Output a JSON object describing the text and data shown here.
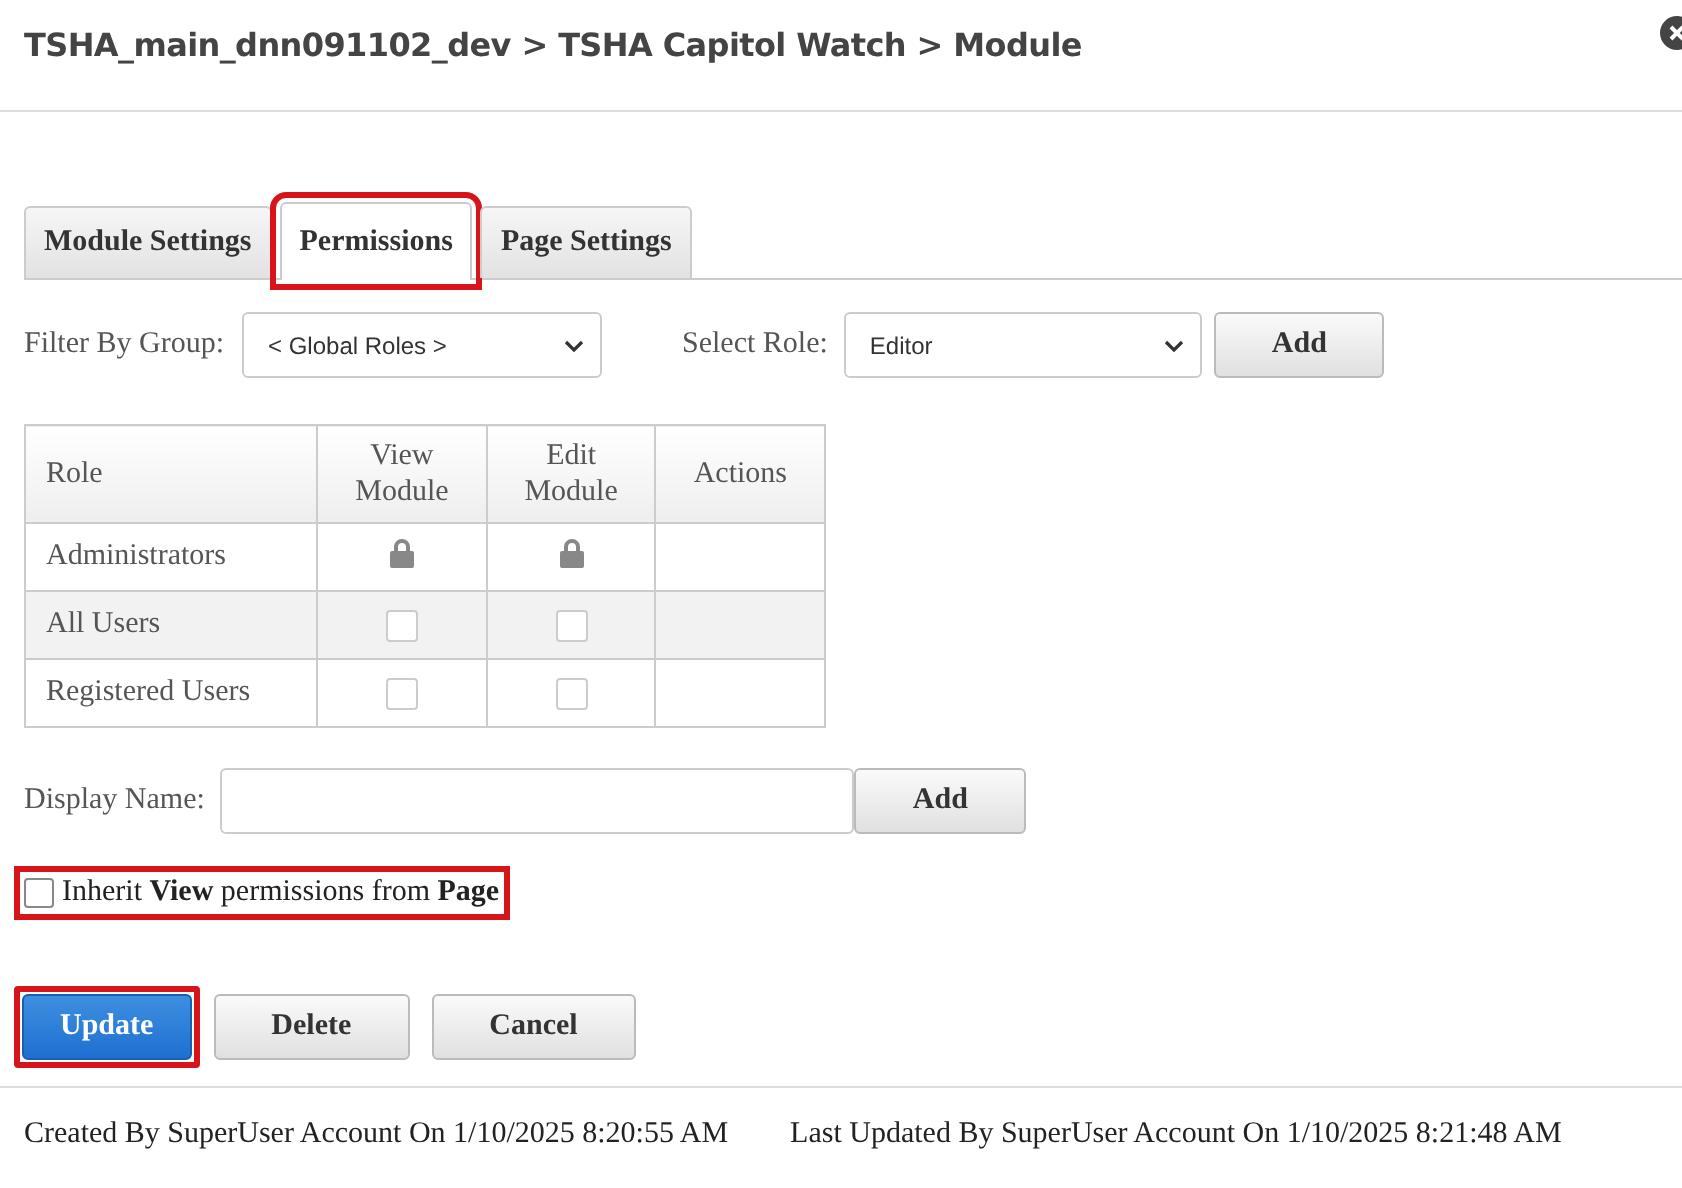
{
  "window": {
    "title": "TSHA_main_dnn091102_dev > TSHA Capitol Watch > Module"
  },
  "tabs": [
    {
      "label": "Module Settings",
      "selected": false,
      "highlighted": false
    },
    {
      "label": "Permissions",
      "selected": true,
      "highlighted": true
    },
    {
      "label": "Page Settings",
      "selected": false,
      "highlighted": false
    }
  ],
  "filter": {
    "group_label": "Filter By Group:",
    "group_value": "< Global Roles >",
    "role_label": "Select Role:",
    "role_value": "Editor",
    "add_button": "Add"
  },
  "table": {
    "columns": [
      "Role",
      "View Module",
      "Edit Module",
      "Actions"
    ],
    "rows": [
      {
        "role": "Administrators",
        "cells": [
          {
            "kind": "locked"
          },
          {
            "kind": "locked"
          }
        ]
      },
      {
        "role": "All Users",
        "cells": [
          {
            "kind": "checkbox",
            "checked": false
          },
          {
            "kind": "checkbox",
            "checked": false
          }
        ]
      },
      {
        "role": "Registered Users",
        "cells": [
          {
            "kind": "checkbox",
            "checked": false
          },
          {
            "kind": "checkbox",
            "checked": false
          }
        ]
      }
    ]
  },
  "display_name": {
    "label": "Display Name:",
    "add_button": "Add"
  },
  "inherit": {
    "label": "Inherit **View** permissions from **Page**",
    "checked": false,
    "highlighted": true
  },
  "buttons": [
    {
      "label": "Update",
      "kind": "primary",
      "highlighted": true
    },
    {
      "label": "Delete",
      "kind": "secondary",
      "highlighted": false
    },
    {
      "label": "Cancel",
      "kind": "secondary",
      "highlighted": false
    }
  ],
  "footer": {
    "created": "Created By SuperUser Account On 1/10/2025 8:20:55 AM",
    "updated": "Last Updated By SuperUser Account On 1/10/2025 8:21:48 AM"
  }
}
